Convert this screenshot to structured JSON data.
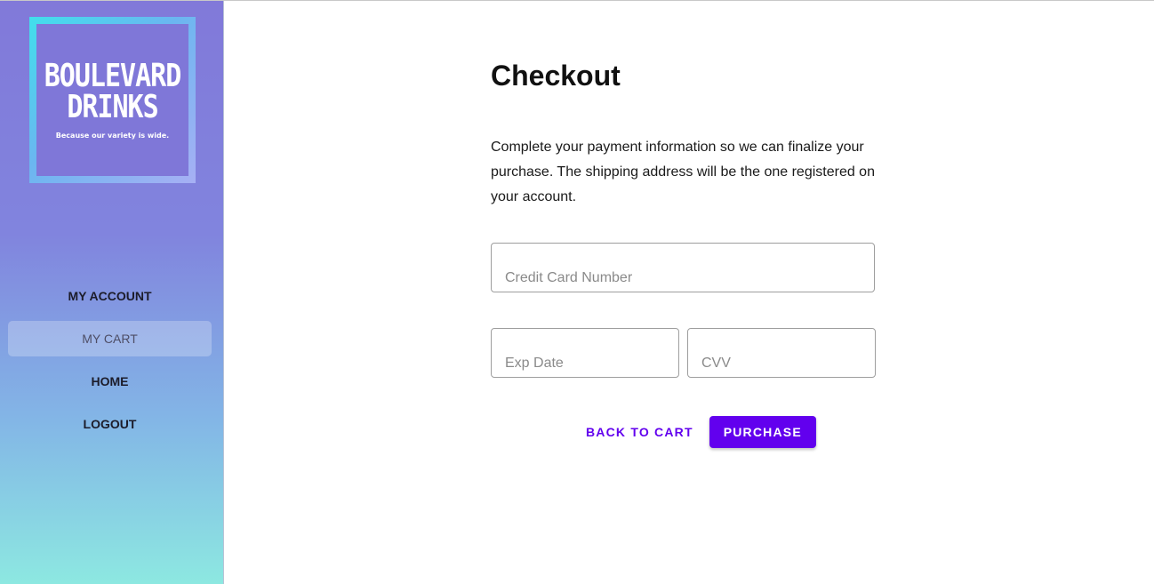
{
  "brand": {
    "logo_line1": "BOULEVARD",
    "logo_line2": "DRINKS",
    "tagline": "Because our variety is wide."
  },
  "sidebar": {
    "items": [
      {
        "label": "MY ACCOUNT",
        "active": false
      },
      {
        "label": "MY CART",
        "active": true
      },
      {
        "label": "HOME",
        "active": false
      },
      {
        "label": "LOGOUT",
        "active": false
      }
    ]
  },
  "checkout": {
    "title": "Checkout",
    "description": "Complete your payment information so we can finalize your purchase. The shipping address will be the one registered on your account.",
    "fields": {
      "card_number": {
        "placeholder": "Credit Card Number",
        "value": ""
      },
      "exp_date": {
        "placeholder": "Exp Date",
        "value": ""
      },
      "cvv": {
        "placeholder": "CVV",
        "value": ""
      }
    },
    "back_label": "BACK TO CART",
    "purchase_label": "PURCHASE"
  },
  "colors": {
    "accent": "#6200ee",
    "sidebar_top": "#8179d9",
    "sidebar_bottom": "#8de8e1"
  }
}
